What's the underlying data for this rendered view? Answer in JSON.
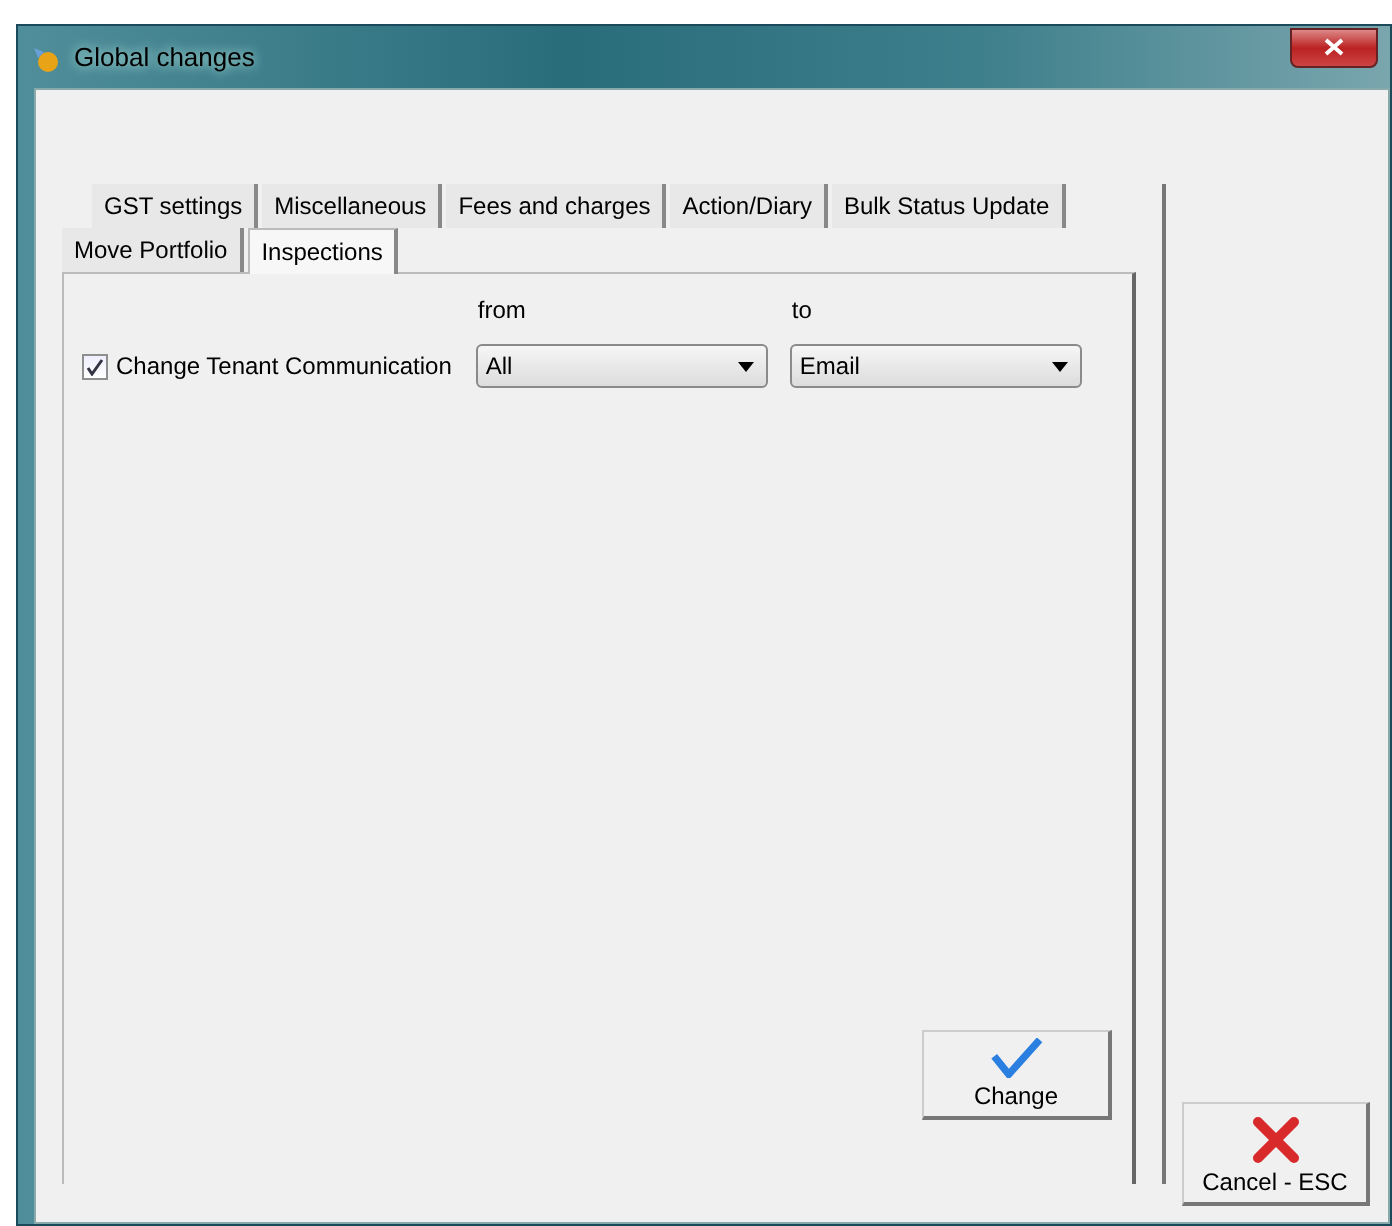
{
  "window": {
    "title": "Global changes"
  },
  "tab_rows": [
    [
      {
        "label": "GST settings",
        "selected": false
      },
      {
        "label": "Miscellaneous",
        "selected": false
      },
      {
        "label": "Fees and charges",
        "selected": false
      },
      {
        "label": "Action/Diary",
        "selected": false
      },
      {
        "label": "Bulk Status Update",
        "selected": false
      }
    ],
    [
      {
        "label": "Move Portfolio",
        "selected": false
      },
      {
        "label": "Inspections",
        "selected": true
      }
    ]
  ],
  "option": {
    "label": "Change Tenant Communication",
    "checked": true
  },
  "dropdowns": [
    {
      "label": "from",
      "value": "All"
    },
    {
      "label": "to",
      "value": "Email"
    }
  ],
  "buttons": {
    "change": "Change",
    "cancel": "Cancel - ESC"
  }
}
